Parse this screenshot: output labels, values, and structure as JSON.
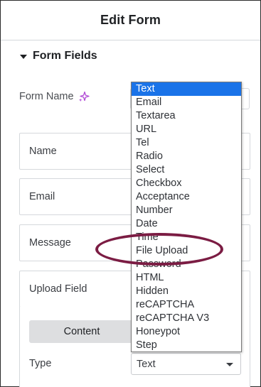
{
  "panel": {
    "title": "Edit Form",
    "section_label": "Form Fields"
  },
  "form_name": {
    "label": "Form Name",
    "icon": "ai-sparkle-icon",
    "value": ""
  },
  "fields": [
    {
      "label": "Name"
    },
    {
      "label": "Email"
    },
    {
      "label": "Message"
    },
    {
      "label": "Upload Field"
    }
  ],
  "upload_field_panel": {
    "tab_label": "Content",
    "type_label": "Type",
    "type_value": "Text"
  },
  "type_dropdown": {
    "selected": "Text",
    "options": [
      "Text",
      "Email",
      "Textarea",
      "URL",
      "Tel",
      "Radio",
      "Select",
      "Checkbox",
      "Acceptance",
      "Number",
      "Date",
      "Time",
      "File Upload",
      "Password",
      "HTML",
      "Hidden",
      "reCAPTCHA",
      "reCAPTCHA V3",
      "Honeypot",
      "Step"
    ],
    "highlighted_option": "File Upload"
  },
  "colors": {
    "selected_option_bg": "#1a73e8",
    "highlight_ring": "#7b1c43",
    "sparkle": "#b14bd6"
  }
}
